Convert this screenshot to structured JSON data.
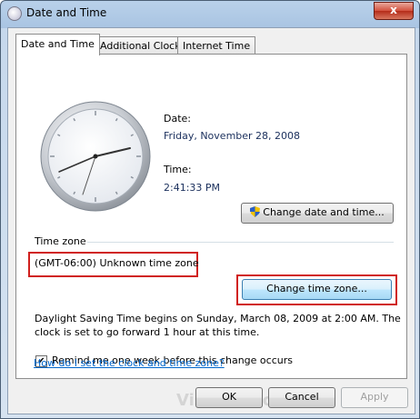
{
  "window": {
    "title": "Date and Time",
    "close_glyph": "x"
  },
  "tabs": [
    {
      "label": "Date and Time",
      "active": true
    },
    {
      "label": "Additional Clocks",
      "active": false
    },
    {
      "label": "Internet Time",
      "active": false
    }
  ],
  "date_section": {
    "date_label": "Date:",
    "date_value": "Friday, November 28, 2008",
    "time_label": "Time:",
    "time_value": "2:41:33 PM"
  },
  "change_datetime_button": "Change date and time...",
  "timezone": {
    "heading": "Time zone",
    "value": "(GMT-06:00) Unknown time zone",
    "change_button": "Change time zone..."
  },
  "dst_info": {
    "line1": "Daylight Saving Time begins on Sunday, March 08, 2009 at 2:00 AM. The",
    "line2": "clock is set to go forward 1 hour at this time."
  },
  "reminder": {
    "label": "Remind me one week before this change occurs",
    "checked": true
  },
  "help_link": "How do I set the clock and time zone?",
  "watermark": "Vistax64.com",
  "footer": {
    "ok": "OK",
    "cancel": "Cancel",
    "apply": "Apply"
  },
  "colors": {
    "highlight_border": "#d0201e",
    "link": "#0066cc"
  },
  "icons": {
    "title": "clock-icon",
    "change_datetime": "uac-shield-icon"
  }
}
